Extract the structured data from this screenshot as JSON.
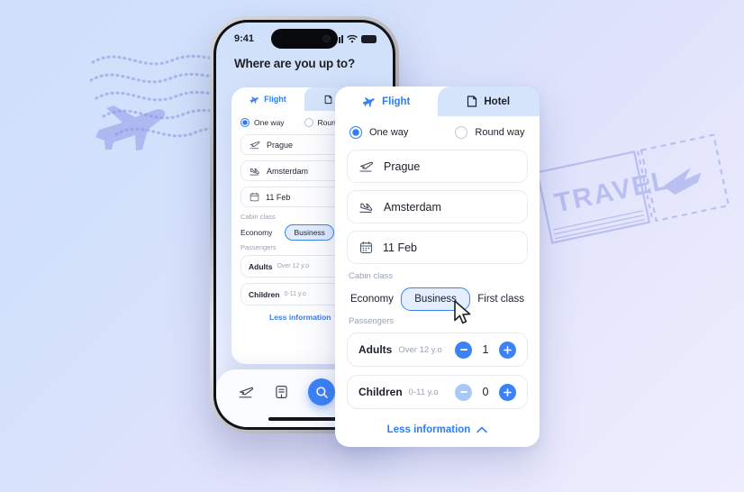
{
  "theme": {
    "accent": "#3b82f6",
    "accent_text": "#2f7df6",
    "tab_inactive_bg": "#d6e4fb",
    "chip_selected_bg": "#e3eefe",
    "muted_text": "#9aa2b4",
    "bg_gradient_from": "#cfe0fb",
    "bg_gradient_to": "#eeedfe"
  },
  "background_decor": {
    "plane_stamp": "airplane-stamp-glyph",
    "postmark_waves": "postmark-wavy-lines",
    "ticket_word": "TRAVEL"
  },
  "phone": {
    "status_bar": {
      "time": "9:41",
      "signal_icon": "cellular-signal-icon",
      "wifi_icon": "wifi-icon",
      "battery_icon": "battery-icon"
    },
    "title": "Where are you up to?",
    "bottom_nav": [
      {
        "icon": "plane-takeoff-icon",
        "name": "flights"
      },
      {
        "icon": "ticket-icon",
        "name": "bookings"
      },
      {
        "icon": "search-icon",
        "name": "search"
      },
      {
        "icon": "profile-icon",
        "name": "profile"
      }
    ]
  },
  "card": {
    "tabs": [
      {
        "label": "Flight",
        "icon": "airplane-icon",
        "active": true
      },
      {
        "label": "Hotel",
        "icon": "hotel-bed-icon",
        "active": false
      }
    ],
    "trip_type": {
      "options": [
        {
          "label": "One way",
          "selected": true
        },
        {
          "label": "Round way",
          "selected": false
        }
      ]
    },
    "fields": [
      {
        "icon": "plane-takeoff-icon",
        "value": "Prague",
        "name": "origin"
      },
      {
        "icon": "plane-landing-icon",
        "value": "Amsterdam",
        "name": "destination"
      },
      {
        "icon": "calendar-icon",
        "value": "11 Feb",
        "name": "date"
      }
    ],
    "cabin_class": {
      "label": "Cabin class",
      "options": [
        {
          "label": "Economy",
          "selected": false
        },
        {
          "label": "Business",
          "selected": true
        },
        {
          "label": "First class",
          "selected": false
        }
      ]
    },
    "passengers": {
      "label": "Passengers",
      "rows": [
        {
          "name": "Adults",
          "age": "Over 12 y.o",
          "count": "1",
          "minus_enabled": true
        },
        {
          "name": "Children",
          "age": "0-11 y.o",
          "count": "0",
          "minus_enabled": false
        }
      ]
    },
    "less_information": {
      "label": "Less information",
      "icon": "chevron-up-icon"
    }
  }
}
